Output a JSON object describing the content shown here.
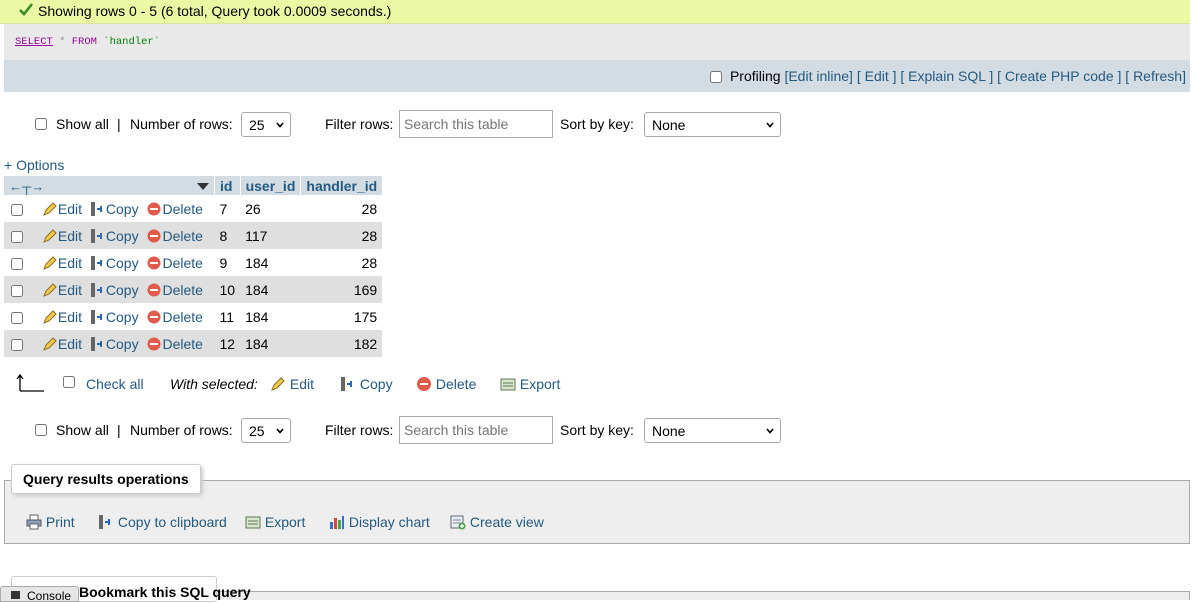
{
  "success": {
    "message": "Showing rows 0 - 5 (6 total, Query took 0.0009 seconds.)"
  },
  "sql": {
    "kw_select": "SELECT",
    "star": "*",
    "kw_from": "FROM",
    "table": "`handler`"
  },
  "sql_tools": {
    "profiling": "Profiling",
    "edit_inline": "[Edit inline]",
    "edit": "[ Edit ]",
    "explain": "[ Explain SQL ]",
    "php": "[ Create PHP code ]",
    "refresh": "[ Refresh]"
  },
  "nav": {
    "show_all": "Show all",
    "separator": "|",
    "num_rows_label": "Number of rows:",
    "num_rows_value": "25",
    "filter_label": "Filter rows:",
    "filter_placeholder": "Search this table",
    "sort_label": "Sort by key:",
    "sort_value": "None"
  },
  "options_link": "+ Options",
  "table": {
    "columns": [
      "id",
      "user_id",
      "handler_id"
    ],
    "actions": {
      "edit": "Edit",
      "copy": "Copy",
      "delete": "Delete"
    },
    "rows": [
      [
        "7",
        "26",
        "28"
      ],
      [
        "8",
        "117",
        "28"
      ],
      [
        "9",
        "184",
        "28"
      ],
      [
        "10",
        "184",
        "169"
      ],
      [
        "11",
        "184",
        "175"
      ],
      [
        "12",
        "184",
        "182"
      ]
    ]
  },
  "bulk": {
    "check_all": "Check all",
    "with_selected": "With selected:",
    "edit": "Edit",
    "copy": "Copy",
    "delete": "Delete",
    "export": "Export"
  },
  "operations": {
    "title": "Query results operations",
    "print": "Print",
    "copy_clipboard": "Copy to clipboard",
    "export": "Export",
    "display_chart": "Display chart",
    "create_view": "Create view"
  },
  "bookmark": {
    "title": "Bookmark this SQL query"
  },
  "console": {
    "label": "Console"
  },
  "colors": {
    "link": "#235a81",
    "success_bg": "#ebf8a4",
    "header_bg": "#d3dce3",
    "row_alt": "#dfdfdf"
  }
}
